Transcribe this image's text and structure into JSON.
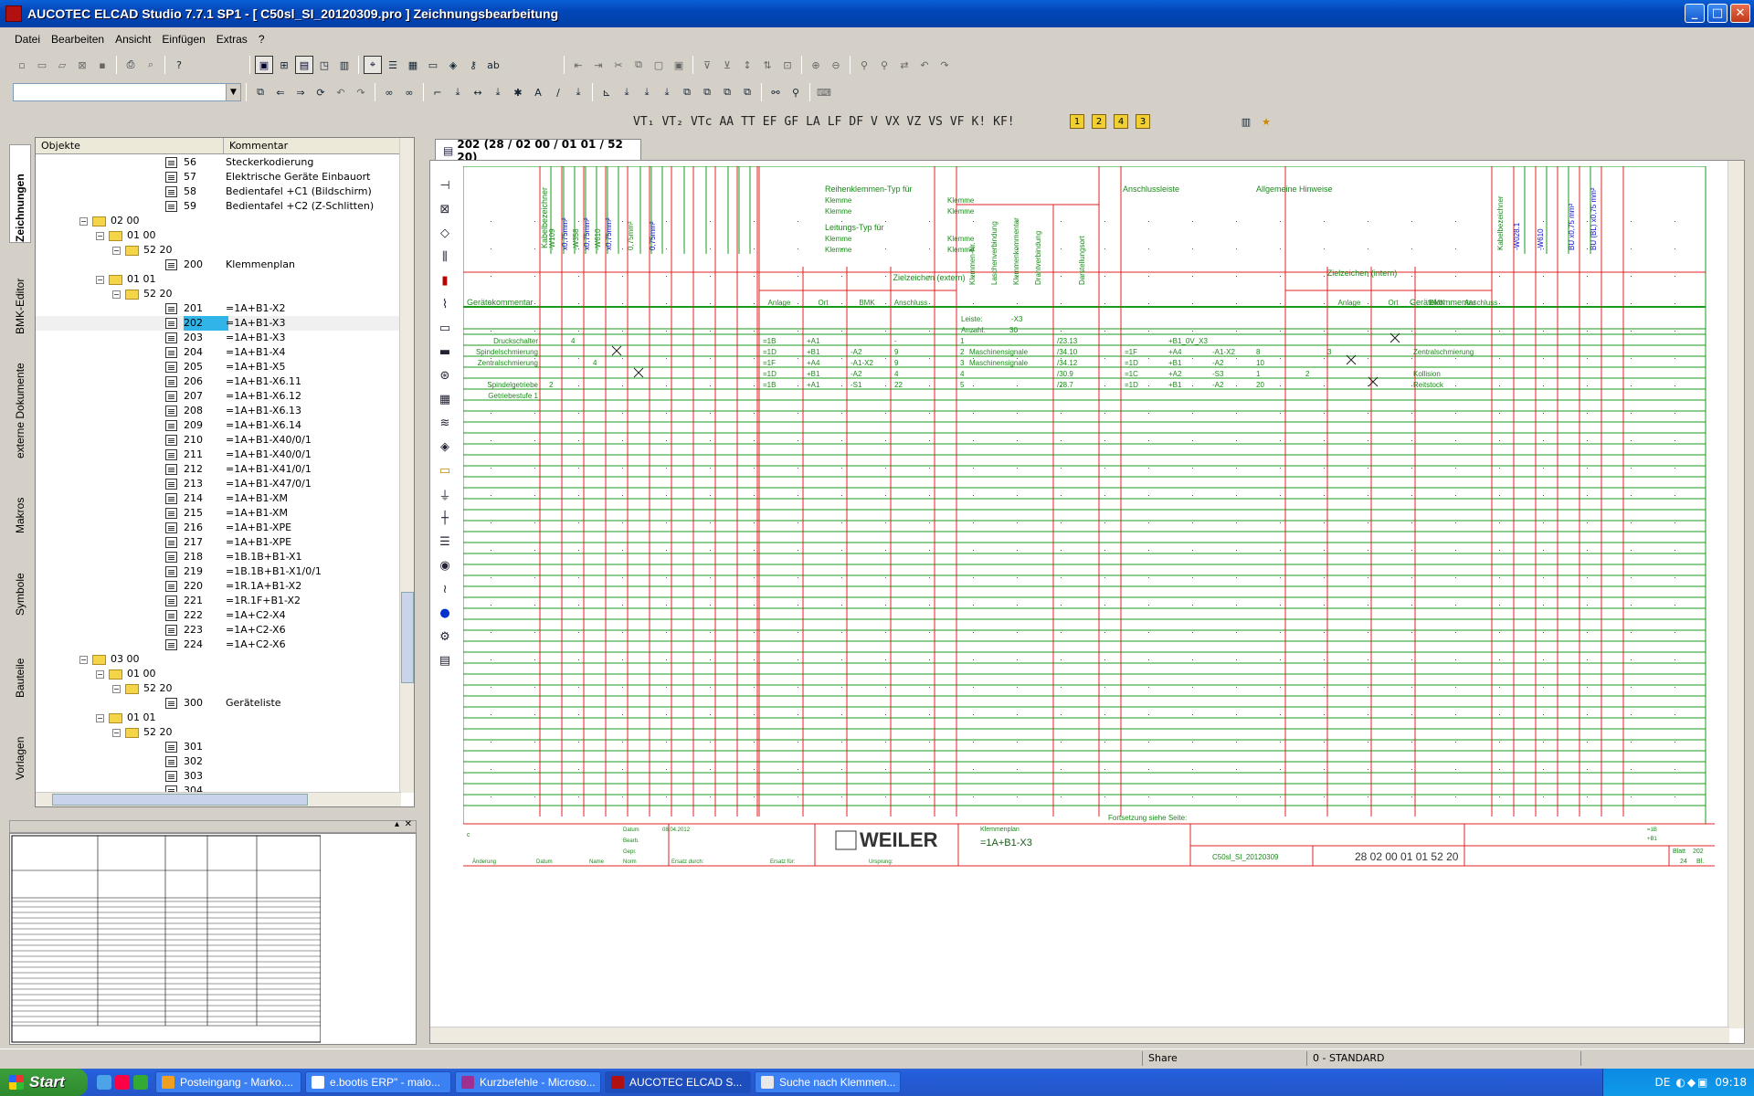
{
  "window": {
    "title": "AUCOTEC   ELCAD Studio 7.7.1 SP1 - [ C50sl_SI_20120309.pro ]  Zeichnungsbearbeitung",
    "minimize": "_",
    "maximize": "□",
    "close": "✕"
  },
  "menu": [
    "Datei",
    "Bearbeiten",
    "Ansicht",
    "Einfügen",
    "Extras",
    "?"
  ],
  "format_toolbar": [
    "VT₁",
    "VT₂",
    "VTc",
    "AA",
    "TT",
    "EF",
    "GF",
    "LA",
    "LF",
    "DF",
    "V",
    "VX",
    "VZ",
    "VS",
    "VF",
    "K!",
    "KF!"
  ],
  "number_buttons": [
    "1",
    "2",
    "4",
    "3"
  ],
  "side_tabs": [
    "Zeichnungen",
    "BMK-Editor",
    "externe Dokumente",
    "Makros",
    "Symbole",
    "Bauteile",
    "Vorlagen"
  ],
  "tree": {
    "col_objects": "Objekte",
    "col_comment": "Kommentar",
    "rows": [
      {
        "type": "doc",
        "num": "56",
        "comment": "Steckerkodierung"
      },
      {
        "type": "doc",
        "num": "57",
        "comment": "Elektrische Geräte Einbauort"
      },
      {
        "type": "doc",
        "num": "58",
        "comment": "Bedientafel +C1 (Bildschirm)"
      },
      {
        "type": "doc",
        "num": "59",
        "comment": "Bedientafel +C2 (Z-Schlitten)"
      },
      {
        "type": "folder",
        "level": 1,
        "label": "02 00"
      },
      {
        "type": "folder",
        "level": 2,
        "label": "01 00"
      },
      {
        "type": "folder",
        "level": 3,
        "label": "52 20"
      },
      {
        "type": "doc",
        "num": "200",
        "comment": "Klemmenplan"
      },
      {
        "type": "folder",
        "level": 2,
        "label": "01 01"
      },
      {
        "type": "folder",
        "level": 3,
        "label": "52 20"
      },
      {
        "type": "doc",
        "num": "201",
        "comment": "=1A+B1-X2"
      },
      {
        "type": "doc",
        "num": "202",
        "comment": "=1A+B1-X3",
        "selected": true
      },
      {
        "type": "doc",
        "num": "203",
        "comment": "=1A+B1-X3"
      },
      {
        "type": "doc",
        "num": "204",
        "comment": "=1A+B1-X4"
      },
      {
        "type": "doc",
        "num": "205",
        "comment": "=1A+B1-X5"
      },
      {
        "type": "doc",
        "num": "206",
        "comment": "=1A+B1-X6.11"
      },
      {
        "type": "doc",
        "num": "207",
        "comment": "=1A+B1-X6.12"
      },
      {
        "type": "doc",
        "num": "208",
        "comment": "=1A+B1-X6.13"
      },
      {
        "type": "doc",
        "num": "209",
        "comment": "=1A+B1-X6.14"
      },
      {
        "type": "doc",
        "num": "210",
        "comment": "=1A+B1-X40/0/1"
      },
      {
        "type": "doc",
        "num": "211",
        "comment": "=1A+B1-X40/0/1"
      },
      {
        "type": "doc",
        "num": "212",
        "comment": "=1A+B1-X41/0/1"
      },
      {
        "type": "doc",
        "num": "213",
        "comment": "=1A+B1-X47/0/1"
      },
      {
        "type": "doc",
        "num": "214",
        "comment": "=1A+B1-XM"
      },
      {
        "type": "doc",
        "num": "215",
        "comment": "=1A+B1-XM"
      },
      {
        "type": "doc",
        "num": "216",
        "comment": "=1A+B1-XPE"
      },
      {
        "type": "doc",
        "num": "217",
        "comment": "=1A+B1-XPE"
      },
      {
        "type": "doc",
        "num": "218",
        "comment": "=1B.1B+B1-X1"
      },
      {
        "type": "doc",
        "num": "219",
        "comment": "=1B.1B+B1-X1/0/1"
      },
      {
        "type": "doc",
        "num": "220",
        "comment": "=1R.1A+B1-X2"
      },
      {
        "type": "doc",
        "num": "221",
        "comment": "=1R.1F+B1-X2"
      },
      {
        "type": "doc",
        "num": "222",
        "comment": "=1A+C2-X4"
      },
      {
        "type": "doc",
        "num": "223",
        "comment": "=1A+C2-X6"
      },
      {
        "type": "doc",
        "num": "224",
        "comment": "=1A+C2-X6"
      },
      {
        "type": "folder",
        "level": 1,
        "label": "03 00"
      },
      {
        "type": "folder",
        "level": 2,
        "label": "01 00"
      },
      {
        "type": "folder",
        "level": 3,
        "label": "52 20"
      },
      {
        "type": "doc",
        "num": "300",
        "comment": "Geräteliste"
      },
      {
        "type": "folder",
        "level": 2,
        "label": "01 01"
      },
      {
        "type": "folder",
        "level": 3,
        "label": "52 20"
      },
      {
        "type": "doc",
        "num": "301",
        "comment": ""
      },
      {
        "type": "doc",
        "num": "302",
        "comment": ""
      },
      {
        "type": "doc",
        "num": "303",
        "comment": ""
      },
      {
        "type": "doc",
        "num": "304",
        "comment": ""
      }
    ]
  },
  "doc_tab": "202 (28 / 02 00 / 01 01 / 52 20)",
  "drawing": {
    "header": {
      "kabelbezeichner": "Kabelbezeichner",
      "cable_cols_left": [
        "-W109",
        "x0,75mm²",
        "-W358",
        "x0,75mm²",
        "-W610",
        "x0,75mm²",
        "0,75mm²",
        "0,75mm²"
      ],
      "reihen_typ": "Reihenklemmen-Typ für",
      "leitungs_typ": "Leitungs-Typ für",
      "klemme": "Klemme",
      "anschlussleiste": "Anschlussleiste",
      "anschluss_cols": [
        "Klemmen-Nr.",
        "Laschenverbindung",
        "Klemmenkommentar",
        "Drahtverbindung",
        "Darstellungsort"
      ],
      "allgemeine_hinweise": "Allgemeine Hinweise",
      "cable_cols_right": [
        "Kabelbezeichner",
        "-W028.1",
        "-W610",
        "BU x0,75 mm²",
        "BU (BL) x0,75 mm²"
      ],
      "zielzeichen_extern": "Zielzeichen (extern)",
      "zielzeichen_intern": "Zielzeichen (intern)",
      "geraetekommentar": "Gerätekommentar",
      "sub_cols": [
        "Anlage",
        "Ort",
        "BMK",
        "Anschluss"
      ],
      "leiste_label": "Leiste:",
      "leiste_value": "-X3",
      "anzahl_label": "Anzahl:",
      "anzahl_value": "30"
    },
    "rows_left": [
      {
        "comment": "Druckschalter",
        "c1": "",
        "c2": "4",
        "x": "",
        "anlage": "=1B",
        "ort": "+A1",
        "bmk": "",
        "ans": "-"
      },
      {
        "comment": "Spindelschmierung",
        "c1": "",
        "c2": "",
        "x": "X1",
        "anlage": "=1D",
        "ort": "+B1",
        "bmk": "-A2",
        "ans": "9"
      },
      {
        "comment": "Zentralschmierung",
        "c1": "",
        "c2": "",
        "c3": "4",
        "anlage": "=1F",
        "ort": "+A4",
        "bmk": "-A1-X2",
        "ans": "9"
      },
      {
        "comment": "",
        "c1": "",
        "c2": "",
        "x": "X2",
        "anlage": "=1D",
        "ort": "+B1",
        "bmk": "-A2",
        "ans": "4"
      },
      {
        "comment": "Spindelgetriebe",
        "c1": "2",
        "c2": "",
        "anlage": "=1B",
        "ort": "+A1",
        "bmk": "-S1",
        "ans": "22"
      },
      {
        "comment": "Getriebestufe 1",
        "c1": "",
        "c2": "",
        "anlage": "",
        "ort": "",
        "bmk": "",
        "ans": ""
      }
    ],
    "rows_mid": [
      {
        "nr": "1",
        "kom": "",
        "ort": "/23.13"
      },
      {
        "nr": "2",
        "kom": "Maschinensignale",
        "ort": "/34.10"
      },
      {
        "nr": "3",
        "kom": "Maschinensignale",
        "ort": "/34.12"
      },
      {
        "nr": "4",
        "kom": "",
        "ort": "/30.9"
      },
      {
        "nr": "5",
        "kom": "",
        "ort": "/28.7"
      }
    ],
    "rows_right": [
      {
        "anlage": "",
        "ort": "+B1_0V_X3",
        "bmk": "",
        "ans": "",
        "n": "",
        "comment": ""
      },
      {
        "anlage": "=1F",
        "ort": "+A4",
        "bmk": "-A1-X2",
        "ans": "8",
        "n": "3",
        "comment": "Zentralschmierung"
      },
      {
        "anlage": "=1D",
        "ort": "+B1",
        "bmk": "-A2",
        "ans": "10",
        "n": "",
        "comment": ""
      },
      {
        "anlage": "=1C",
        "ort": "+A2",
        "bmk": "-S3",
        "ans": "1",
        "n": "2",
        "comment": "Kollision"
      },
      {
        "anlage": "=1D",
        "ort": "+B1",
        "bmk": "-A2",
        "ans": "20",
        "n": "",
        "comment": "Reitstock"
      }
    ],
    "fortsetzung": "Fortsetzung siehe Seite:",
    "titleblock": {
      "datum": "Datum",
      "datum_val": "08.04.2012",
      "bearb": "Bearb.",
      "gepr": "Gepr.",
      "norm": "Norm",
      "aenderung": "Änderung",
      "datum2": "Datum",
      "name": "Name",
      "ersatz_durch": "Ersatz durch:",
      "ersatz_fuer": "Ersatz für:",
      "ursprung": "Ursprung:",
      "logo": "WEILER",
      "klemmenplan": "Klemmenplan",
      "klemme_id": "=1A+B1-X3",
      "project": "C50sl_SI_20120309",
      "code": "28 02 00 01 01 52 20",
      "blatt": "Blatt",
      "blatt_val": "202",
      "bl_count": "24",
      "bl": "Bl.",
      "s1": "=1B",
      "s2": "+B1"
    }
  },
  "status": {
    "share": "Share",
    "standard": "0 - STANDARD"
  },
  "taskbar": {
    "start": "Start",
    "tasks": [
      {
        "label": "Posteingang - Marko....",
        "color": "#f0a020"
      },
      {
        "label": "e.bootis ERP\" - malo...",
        "color": "#ffffff"
      },
      {
        "label": "Kurzbefehle - Microso...",
        "color": "#a03090"
      },
      {
        "label": "AUCOTEC   ELCAD S...",
        "color": "#b01010",
        "active": true
      },
      {
        "label": "Suche nach Klemmen...",
        "color": "#e8e8e8"
      }
    ],
    "lang": "DE",
    "time": "09:18"
  }
}
